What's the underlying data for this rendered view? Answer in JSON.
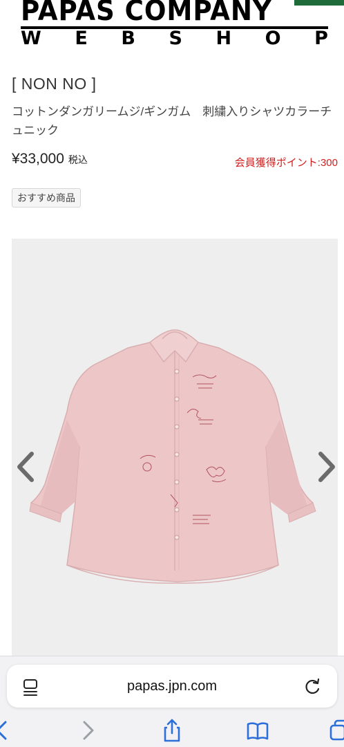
{
  "header": {
    "logo_line1": "PAPAS COMPANY",
    "logo_line2": [
      "W",
      "E",
      "B",
      "S",
      "H",
      "O",
      "P"
    ]
  },
  "product": {
    "brand": "[ NON NO ]",
    "name": "コットンダンガリームジ/ギンガム　刺繍入りシャツカラーチュニック",
    "price": "¥33,000",
    "tax_label": "税込",
    "points": "会員獲得ポイント:300",
    "tag": "おすすめ商品"
  },
  "browser": {
    "url": "papas.jpn.com"
  },
  "colors": {
    "points_red": "#d11f1f",
    "shirt_pink": "#edc7c8",
    "embroidery": "#b0505e"
  },
  "icons": [
    "hamburger-menu-icon",
    "reload-icon",
    "back-icon",
    "forward-icon",
    "share-icon",
    "bookmarks-icon",
    "tabs-icon",
    "chevron-left-icon",
    "chevron-right-icon"
  ]
}
